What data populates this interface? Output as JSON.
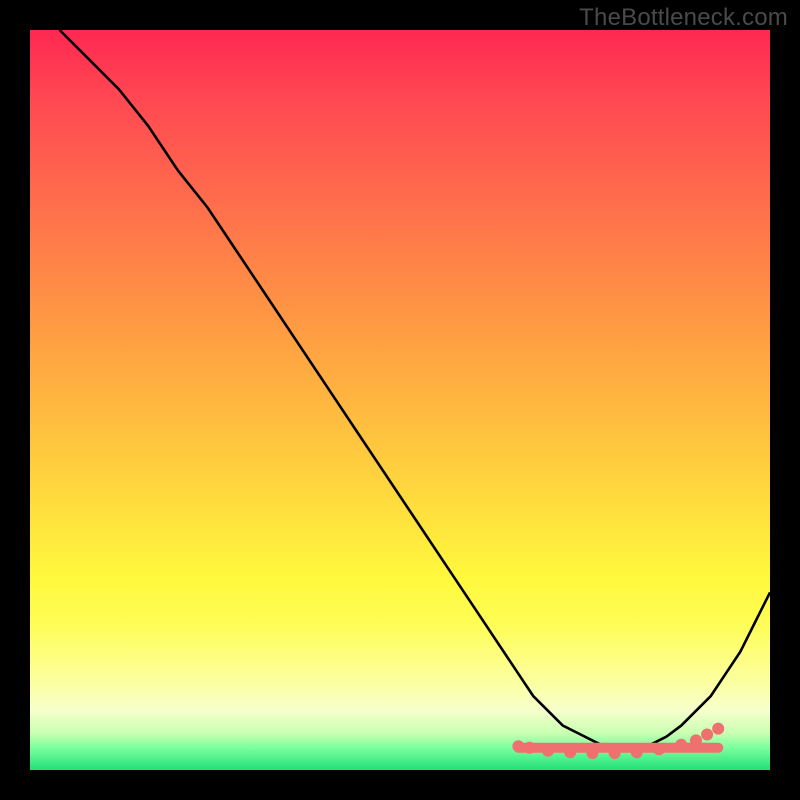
{
  "watermark": "TheBottleneck.com",
  "colors": {
    "gradient_top": "#ff2851",
    "gradient_mid": "#ffe23d",
    "gradient_bottom": "#22e07a",
    "frame": "#000000",
    "curve": "#000000",
    "markers": "#f06f6f",
    "watermark_text": "#4a4a4a"
  },
  "chart_data": {
    "type": "line",
    "title": "",
    "xlabel": "",
    "ylabel": "",
    "xlim": [
      0,
      100
    ],
    "ylim": [
      0,
      100
    ],
    "grid": false,
    "legend": false,
    "annotations": [],
    "series": [
      {
        "name": "bottleneck-curve",
        "x": [
          4,
          8,
          12,
          16,
          20,
          24,
          28,
          32,
          36,
          40,
          44,
          48,
          52,
          56,
          60,
          64,
          66,
          68,
          70,
          72,
          74,
          76,
          78,
          80,
          82,
          84,
          86,
          88,
          90,
          92,
          94,
          96,
          98,
          100
        ],
        "y": [
          100,
          96,
          92,
          87,
          81,
          76,
          70,
          64,
          58,
          52,
          46,
          40,
          34,
          28,
          22,
          16,
          13,
          10,
          8,
          6,
          5,
          4,
          3,
          3,
          3,
          3.5,
          4.5,
          6,
          8,
          10,
          13,
          16,
          20,
          24
        ]
      }
    ],
    "highlight": {
      "name": "optimal-range",
      "band_x": [
        66,
        93
      ],
      "band_y": 3,
      "dots": [
        {
          "x": 66.0,
          "y": 3.2
        },
        {
          "x": 67.5,
          "y": 3.0
        },
        {
          "x": 70.0,
          "y": 2.6
        },
        {
          "x": 73.0,
          "y": 2.4
        },
        {
          "x": 76.0,
          "y": 2.3
        },
        {
          "x": 79.0,
          "y": 2.3
        },
        {
          "x": 82.0,
          "y": 2.4
        },
        {
          "x": 85.0,
          "y": 2.8
        },
        {
          "x": 88.0,
          "y": 3.4
        },
        {
          "x": 90.0,
          "y": 4.0
        },
        {
          "x": 91.5,
          "y": 4.8
        },
        {
          "x": 93.0,
          "y": 5.6
        }
      ]
    }
  }
}
